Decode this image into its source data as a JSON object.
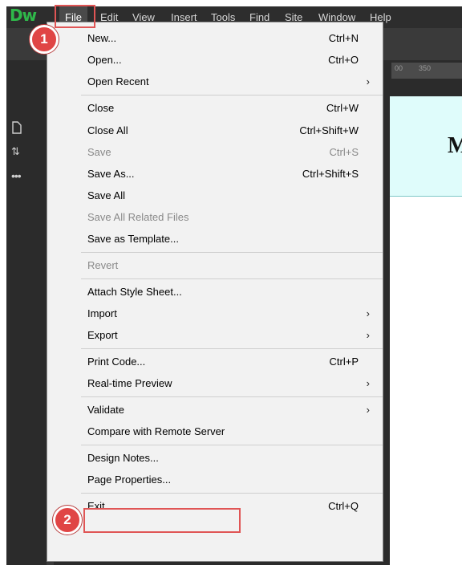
{
  "app": {
    "logo": "Dw"
  },
  "menubar": {
    "items": [
      "File",
      "Edit",
      "View",
      "Insert",
      "Tools",
      "Find",
      "Site",
      "Window",
      "Help"
    ]
  },
  "ruler": {
    "tick_labels": [
      "00",
      "350"
    ]
  },
  "canvas": {
    "banner_text": "M"
  },
  "callouts": [
    "1",
    "2"
  ],
  "file_menu": {
    "new": {
      "label": "New...",
      "shortcut": "Ctrl+N"
    },
    "open": {
      "label": "Open...",
      "shortcut": "Ctrl+O"
    },
    "open_recent": {
      "label": "Open Recent",
      "arrow": "›"
    },
    "close": {
      "label": "Close",
      "shortcut": "Ctrl+W"
    },
    "close_all": {
      "label": "Close All",
      "shortcut": "Ctrl+Shift+W"
    },
    "save": {
      "label": "Save",
      "shortcut": "Ctrl+S"
    },
    "save_as": {
      "label": "Save As...",
      "shortcut": "Ctrl+Shift+S"
    },
    "save_all": {
      "label": "Save All"
    },
    "save_all_related": {
      "label": "Save All Related Files"
    },
    "save_template": {
      "label": "Save as Template..."
    },
    "revert": {
      "label": "Revert"
    },
    "attach_style": {
      "label": "Attach Style Sheet..."
    },
    "import": {
      "label": "Import",
      "arrow": "›"
    },
    "export": {
      "label": "Export",
      "arrow": "›"
    },
    "print_code": {
      "label": "Print Code...",
      "shortcut": "Ctrl+P"
    },
    "realtime_preview": {
      "label": "Real-time Preview",
      "arrow": "›"
    },
    "validate": {
      "label": "Validate",
      "arrow": "›"
    },
    "compare_remote": {
      "label": "Compare with Remote Server"
    },
    "design_notes": {
      "label": "Design Notes..."
    },
    "page_properties": {
      "label": "Page Properties..."
    },
    "exit": {
      "label": "Exit",
      "shortcut": "Ctrl+Q"
    }
  },
  "colors": {
    "highlight": "#e05555",
    "callout": "#e04545",
    "logo": "#2fb84a"
  }
}
